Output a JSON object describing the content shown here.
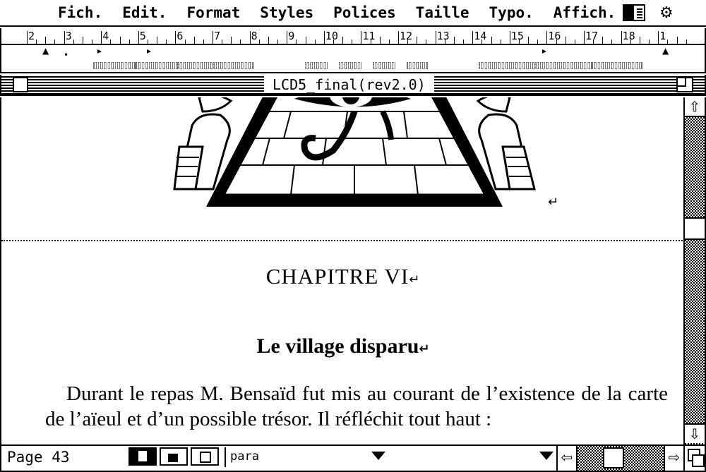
{
  "menubar": {
    "items": [
      "Fich.",
      "Edit.",
      "Format",
      "Styles",
      "Polices",
      "Taille",
      "Typo.",
      "Affich."
    ]
  },
  "ruler": {
    "labels": [
      "2",
      "3",
      "4",
      "5",
      "6",
      "7",
      "8",
      "9",
      "10",
      "11",
      "12",
      "13",
      "14",
      "15",
      "16",
      "17",
      "18",
      "1"
    ]
  },
  "window": {
    "title": "LCD5_final(rev2.0)"
  },
  "document": {
    "chapter": "CHAPITRE VI",
    "title": "Le village disparu",
    "body": "Durant le repas M. Bensaïd fut mis au courant de l’existence de la carte de l’aïeul et d’un possible trésor. Il réfléchit tout haut :"
  },
  "status": {
    "page_label": "Page 43",
    "style_name": "para"
  },
  "icons": {
    "apple": "apple-icon",
    "return": "↵"
  }
}
